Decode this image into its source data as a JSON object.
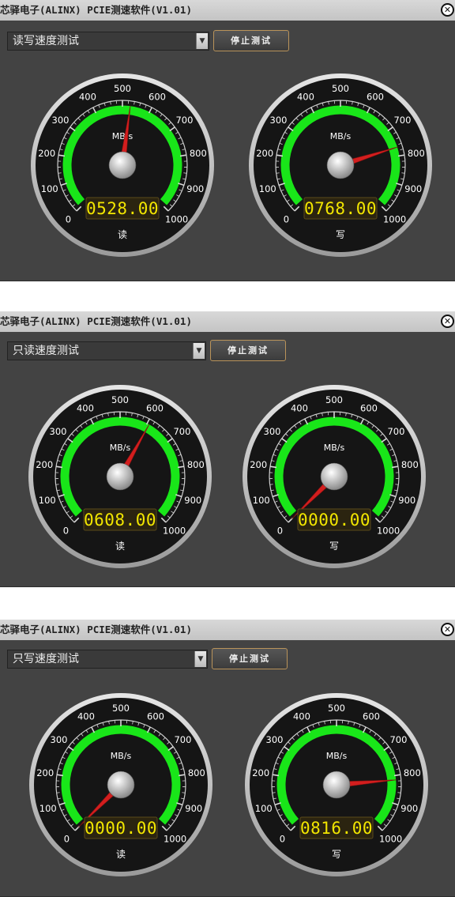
{
  "windows": [
    {
      "title": "芯驿电子(ALINX) PCIE测速软件(V1.01)",
      "close_glyph": "✕",
      "mode_select": "读写速度测试",
      "stop_button": "停止测试",
      "gauges": [
        {
          "unit": "MB/s",
          "label": "读",
          "readout": "0528.00",
          "value": 528
        },
        {
          "unit": "MB/s",
          "label": "写",
          "readout": "0768.00",
          "value": 768
        }
      ]
    },
    {
      "title": "芯驿电子(ALINX) PCIE测速软件(V1.01)",
      "close_glyph": "✕",
      "mode_select": "只读速度测试",
      "stop_button": "停止测试",
      "gauges": [
        {
          "unit": "MB/s",
          "label": "读",
          "readout": "0608.00",
          "value": 608
        },
        {
          "unit": "MB/s",
          "label": "写",
          "readout": "0000.00",
          "value": 0
        }
      ]
    },
    {
      "title": "芯驿电子(ALINX) PCIE测速软件(V1.01)",
      "close_glyph": "✕",
      "mode_select": "只写速度测试",
      "stop_button": "停止测试",
      "gauges": [
        {
          "unit": "MB/s",
          "label": "读",
          "readout": "0000.00",
          "value": 0
        },
        {
          "unit": "MB/s",
          "label": "写",
          "readout": "0816.00",
          "value": 816
        }
      ]
    }
  ],
  "scale": {
    "min": 0,
    "max": 1000,
    "tick_labels": [
      "0",
      "100",
      "200",
      "300",
      "400",
      "500",
      "600",
      "700",
      "800",
      "900",
      "1000"
    ]
  },
  "colors": {
    "arc": "#19e619",
    "needle": "#d31e1e",
    "readout_text": "#f2e600",
    "window_bg": "#434343",
    "button_border": "#b9935a"
  },
  "icons": {
    "close": "close-icon",
    "dropdown": "chevron-down-icon"
  }
}
